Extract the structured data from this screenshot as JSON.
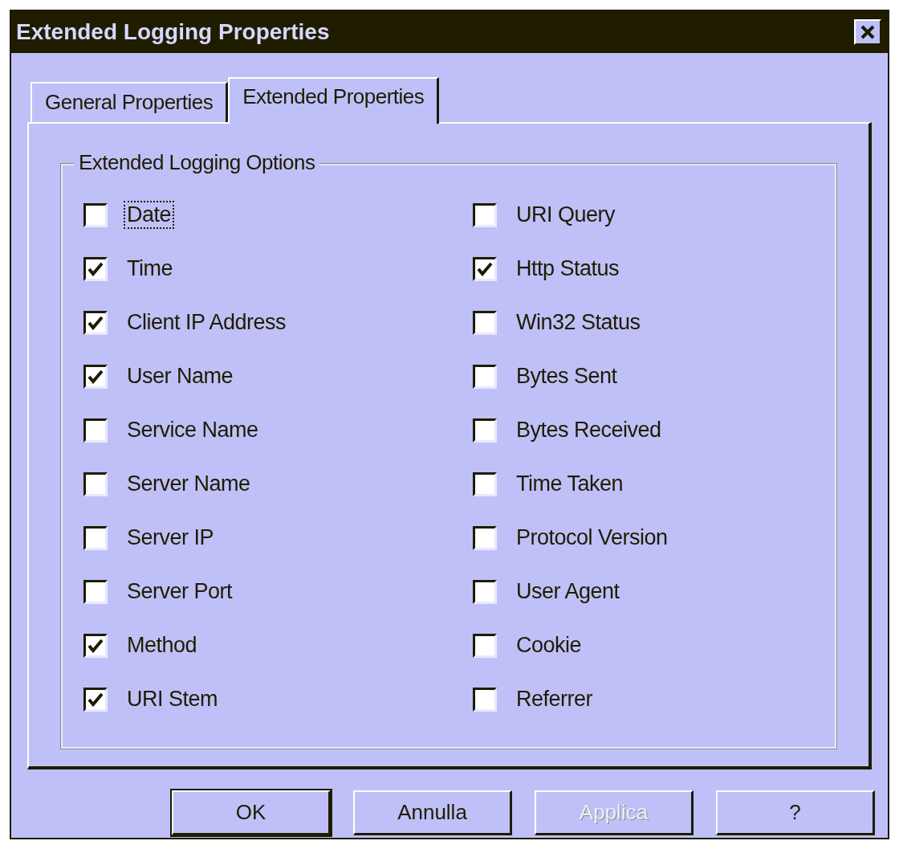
{
  "window": {
    "title": "Extended Logging Properties"
  },
  "tabs": [
    {
      "label": "General Properties",
      "selected": false
    },
    {
      "label": "Extended Properties",
      "selected": true
    }
  ],
  "group": {
    "title": "Extended Logging Options"
  },
  "options_left": [
    {
      "label": "Date",
      "checked": false,
      "focused": true
    },
    {
      "label": "Time",
      "checked": true,
      "focused": false
    },
    {
      "label": "Client IP Address",
      "checked": true,
      "focused": false
    },
    {
      "label": "User Name",
      "checked": true,
      "focused": false
    },
    {
      "label": "Service Name",
      "checked": false,
      "focused": false
    },
    {
      "label": "Server Name",
      "checked": false,
      "focused": false
    },
    {
      "label": "Server IP",
      "checked": false,
      "focused": false
    },
    {
      "label": "Server Port",
      "checked": false,
      "focused": false
    },
    {
      "label": "Method",
      "checked": true,
      "focused": false
    },
    {
      "label": "URI Stem",
      "checked": true,
      "focused": false
    }
  ],
  "options_right": [
    {
      "label": "URI Query",
      "checked": false,
      "focused": false
    },
    {
      "label": "Http Status",
      "checked": true,
      "focused": false
    },
    {
      "label": "Win32 Status",
      "checked": false,
      "focused": false
    },
    {
      "label": "Bytes Sent",
      "checked": false,
      "focused": false
    },
    {
      "label": "Bytes Received",
      "checked": false,
      "focused": false
    },
    {
      "label": "Time Taken",
      "checked": false,
      "focused": false
    },
    {
      "label": "Protocol Version",
      "checked": false,
      "focused": false
    },
    {
      "label": "User Agent",
      "checked": false,
      "focused": false
    },
    {
      "label": "Cookie",
      "checked": false,
      "focused": false
    },
    {
      "label": "Referrer",
      "checked": false,
      "focused": false
    }
  ],
  "buttons": [
    {
      "label": "OK",
      "disabled": false,
      "default": true
    },
    {
      "label": "Annulla",
      "disabled": false,
      "default": false
    },
    {
      "label": "Applica",
      "disabled": true,
      "default": false
    },
    {
      "label": "?",
      "disabled": false,
      "default": false
    }
  ]
}
